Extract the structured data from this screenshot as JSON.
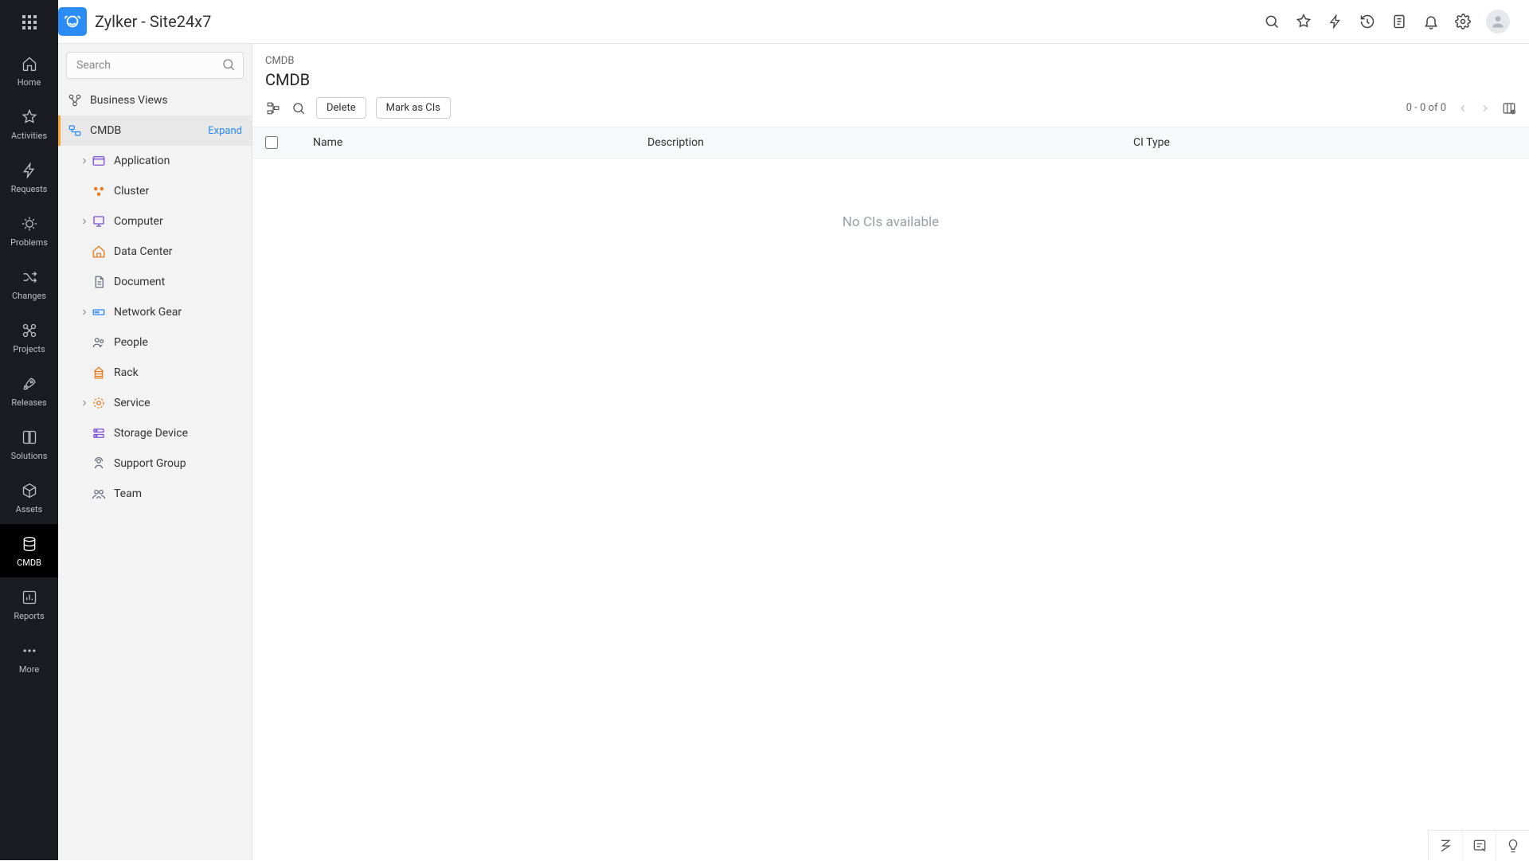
{
  "brand_title": "Zylker - Site24x7",
  "search": {
    "placeholder": "Search"
  },
  "nav": {
    "items": [
      {
        "label": "Home"
      },
      {
        "label": "Activities"
      },
      {
        "label": "Requests"
      },
      {
        "label": "Problems"
      },
      {
        "label": "Changes"
      },
      {
        "label": "Projects"
      },
      {
        "label": "Releases"
      },
      {
        "label": "Solutions"
      },
      {
        "label": "Assets"
      },
      {
        "label": "CMDB"
      },
      {
        "label": "Reports"
      },
      {
        "label": "More"
      }
    ]
  },
  "tree": {
    "business_views": "Business Views",
    "cmdb": "CMDB",
    "expand": "Expand",
    "children": [
      {
        "label": "Application",
        "expandable": true
      },
      {
        "label": "Cluster",
        "expandable": false
      },
      {
        "label": "Computer",
        "expandable": true
      },
      {
        "label": "Data Center",
        "expandable": false
      },
      {
        "label": "Document",
        "expandable": false
      },
      {
        "label": "Network Gear",
        "expandable": true
      },
      {
        "label": "People",
        "expandable": false
      },
      {
        "label": "Rack",
        "expandable": false
      },
      {
        "label": "Service",
        "expandable": true
      },
      {
        "label": "Storage Device",
        "expandable": false
      },
      {
        "label": "Support Group",
        "expandable": false
      },
      {
        "label": "Team",
        "expandable": false
      }
    ]
  },
  "main": {
    "breadcrumb": "CMDB",
    "title": "CMDB",
    "delete_label": "Delete",
    "mark_label": "Mark as CIs",
    "pager": "0 - 0 of 0",
    "columns": {
      "name": "Name",
      "desc": "Description",
      "type": "CI Type"
    },
    "empty": "No CIs available"
  }
}
